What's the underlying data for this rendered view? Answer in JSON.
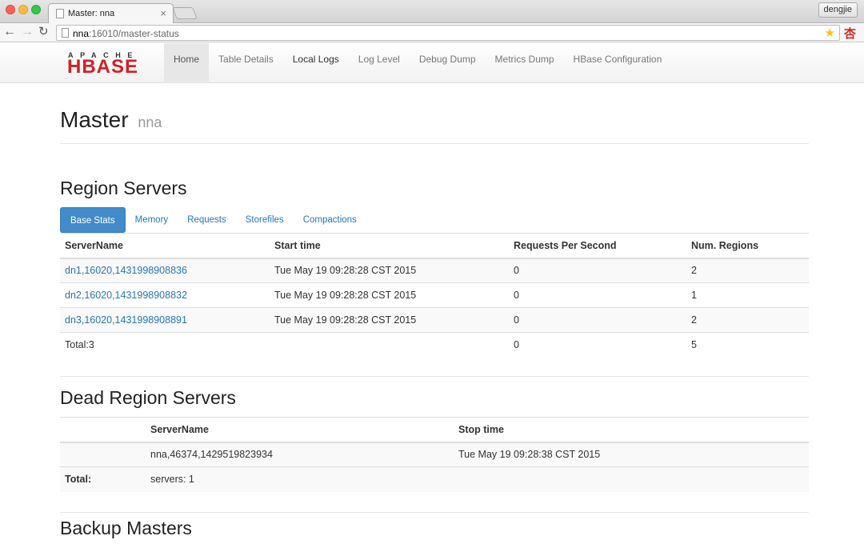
{
  "browser": {
    "tab_title": "Master: nna",
    "tab_close": "×",
    "user": "dengjie",
    "url_host": "nna",
    "url_rest": ":16010/master-status",
    "back": "←",
    "forward": "→",
    "reload": "↻",
    "star": "★",
    "ext": "杏"
  },
  "navbar": {
    "logo_top": "APACHE",
    "logo_main": "HBASE",
    "items": [
      "Home",
      "Table Details",
      "Local Logs",
      "Log Level",
      "Debug Dump",
      "Metrics Dump",
      "HBase Configuration"
    ]
  },
  "header": {
    "title": "Master",
    "host": "nna"
  },
  "region_servers": {
    "heading": "Region Servers",
    "tabs": [
      "Base Stats",
      "Memory",
      "Requests",
      "Storefiles",
      "Compactions"
    ],
    "columns": [
      "ServerName",
      "Start time",
      "Requests Per Second",
      "Num. Regions"
    ],
    "rows": [
      [
        "dn1,16020,1431998908836",
        "Tue May 19 09:28:28 CST 2015",
        "0",
        "2"
      ],
      [
        "dn2,16020,1431998908832",
        "Tue May 19 09:28:28 CST 2015",
        "0",
        "1"
      ],
      [
        "dn3,16020,1431998908891",
        "Tue May 19 09:28:28 CST 2015",
        "0",
        "2"
      ]
    ],
    "total": [
      "Total:3",
      "",
      "0",
      "5"
    ]
  },
  "dead_region_servers": {
    "heading": "Dead Region Servers",
    "columns": [
      "",
      "ServerName",
      "Stop time"
    ],
    "rows": [
      [
        "",
        "nna,46374,1429519823934",
        "Tue May 19 09:28:38 CST 2015"
      ]
    ],
    "total_label": "Total:",
    "total_value": "servers: 1"
  },
  "backup_masters": {
    "heading": "Backup Masters"
  }
}
